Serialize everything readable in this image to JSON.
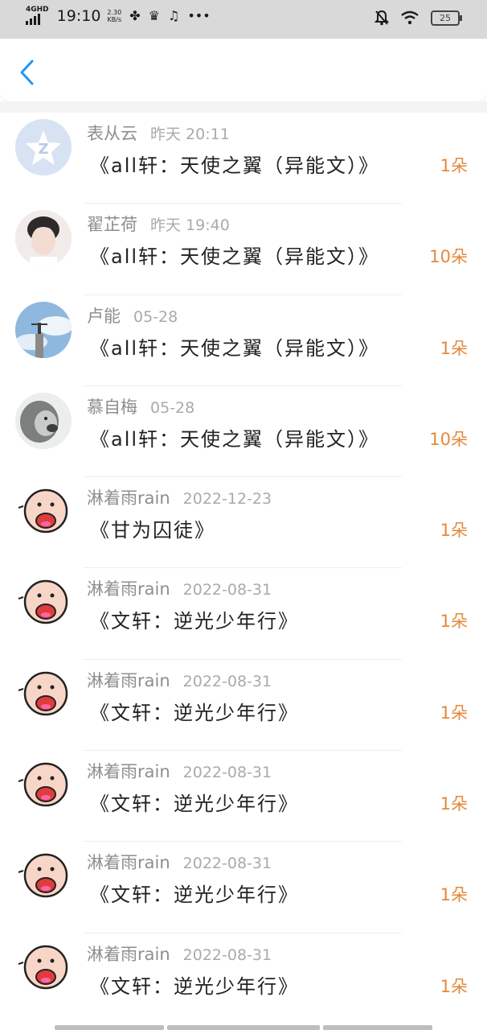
{
  "status": {
    "network": "4GHD",
    "time": "19:10",
    "speed_value": "2.30",
    "speed_unit": "KB/s",
    "battery": "25"
  },
  "nav": {
    "back_icon": "chevron-left-icon"
  },
  "items": [
    {
      "name": "表从云",
      "date": "昨天 20:11",
      "title": "《all轩：天使之翼（异能文）》",
      "count": "1朵",
      "avatar": "qzone-default"
    },
    {
      "name": "翟芷荷",
      "date": "昨天 19:40",
      "title": "《all轩：天使之翼（异能文）》",
      "count": "10朵",
      "avatar": "boy-photo"
    },
    {
      "name": "卢能",
      "date": "05-28",
      "title": "《all轩：天使之翼（异能文）》",
      "count": "1朵",
      "avatar": "sky-statue"
    },
    {
      "name": "慕自梅",
      "date": "05-28",
      "title": "《all轩：天使之翼（异能文）》",
      "count": "10朵",
      "avatar": "lion"
    },
    {
      "name": "淋着雨rain",
      "date": "2022-12-23",
      "title": "《甘为囚徒》",
      "count": "1朵",
      "avatar": "cartoon-shouting"
    },
    {
      "name": "淋着雨rain",
      "date": "2022-08-31",
      "title": "《文轩：逆光少年行》",
      "count": "1朵",
      "avatar": "cartoon-shouting"
    },
    {
      "name": "淋着雨rain",
      "date": "2022-08-31",
      "title": "《文轩：逆光少年行》",
      "count": "1朵",
      "avatar": "cartoon-shouting"
    },
    {
      "name": "淋着雨rain",
      "date": "2022-08-31",
      "title": "《文轩：逆光少年行》",
      "count": "1朵",
      "avatar": "cartoon-shouting"
    },
    {
      "name": "淋着雨rain",
      "date": "2022-08-31",
      "title": "《文轩：逆光少年行》",
      "count": "1朵",
      "avatar": "cartoon-shouting"
    },
    {
      "name": "淋着雨rain",
      "date": "2022-08-31",
      "title": "《文轩：逆光少年行》",
      "count": "1朵",
      "avatar": "cartoon-shouting"
    }
  ],
  "colors": {
    "accent": "#2196f3",
    "count": "#e5883a",
    "name": "#8e8e8e",
    "date": "#aaaaaa",
    "title": "#222222"
  }
}
